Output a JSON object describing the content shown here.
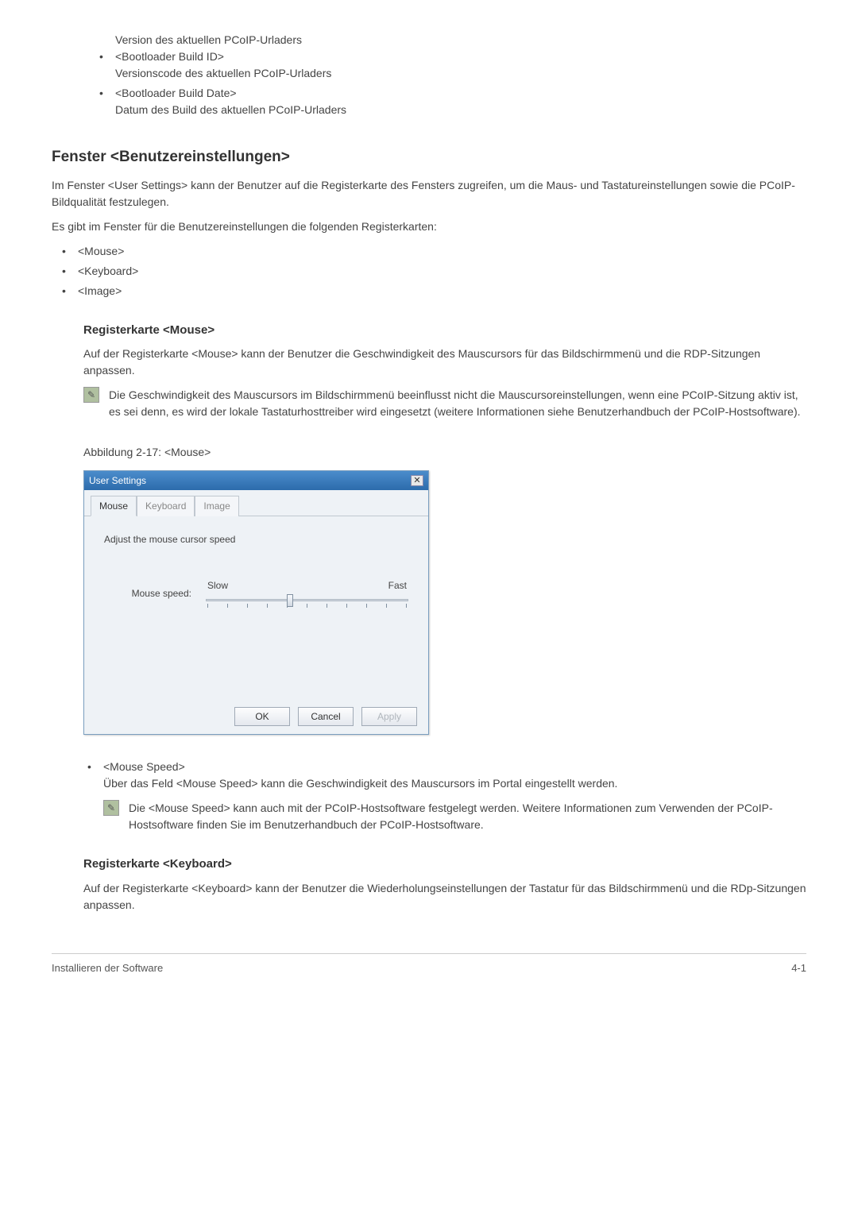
{
  "top_list": {
    "line0": "Version des aktuellen PCoIP-Urladers",
    "item1_title": "<Bootloader Build ID>",
    "item1_desc": "Versionscode des aktuellen PCoIP-Urladers",
    "item2_title": "<Bootloader Build Date>",
    "item2_desc": "Datum des Build des aktuellen PCoIP-Urladers"
  },
  "h2_user_settings": "Fenster <Benutzereinstellungen>",
  "p_user_settings_intro": "Im Fenster <User Settings> kann der Benutzer auf die Registerkarte des Fensters zugreifen, um die Maus- und Tastatureinstellungen sowie die PCoIP-Bildqualität festzulegen.",
  "p_user_settings_tabs": "Es gibt im Fenster für die Benutzereinstellungen die folgenden Registerkarten:",
  "tabs_list": {
    "t1": "<Mouse>",
    "t2": "<Keyboard>",
    "t3": "<Image>"
  },
  "h3_mouse": "Registerkarte <Mouse>",
  "p_mouse_intro": "Auf der Registerkarte <Mouse> kann der Benutzer die Geschwindigkeit des Mauscursors für das Bildschirmmenü und die RDP-Sitzungen anpassen.",
  "note_mouse": "Die Geschwindigkeit des Mauscursors im Bildschirmmenü beeinflusst nicht die Mauscursoreinstellungen, wenn eine PCoIP-Sitzung aktiv ist, es sei denn, es wird der lokale Tastaturhosttreiber wird eingesetzt (weitere Informationen siehe Benutzerhandbuch der PCoIP-Hostsoftware).",
  "figcap_mouse": "Abbildung 2-17: <Mouse>",
  "dialog": {
    "title": "User Settings",
    "tab_mouse": "Mouse",
    "tab_keyboard": "Keyboard",
    "tab_image": "Image",
    "instr": "Adjust the mouse cursor speed",
    "label_speed": "Mouse speed:",
    "slow": "Slow",
    "fast": "Fast",
    "ok": "OK",
    "cancel": "Cancel",
    "apply": "Apply"
  },
  "mouse_speed_list": {
    "title": "<Mouse Speed>",
    "desc": "Über das Feld <Mouse Speed> kann die Geschwindigkeit des Mauscursors im Portal eingestellt werden."
  },
  "note_mouse_speed": "Die <Mouse Speed> kann auch mit der PCoIP-Hostsoftware festgelegt werden. Weitere Informationen zum Verwenden der PCoIP-Hostsoftware finden Sie im Benutzerhandbuch der PCoIP-Hostsoftware.",
  "h3_keyboard": "Registerkarte <Keyboard>",
  "p_keyboard_intro": "Auf der Registerkarte <Keyboard> kann der Benutzer die Wiederholungseinstellungen der Tastatur für das Bildschirmmenü und die RDp-Sitzungen anpassen.",
  "footer_left": "Installieren der Software",
  "footer_right": "4-1"
}
